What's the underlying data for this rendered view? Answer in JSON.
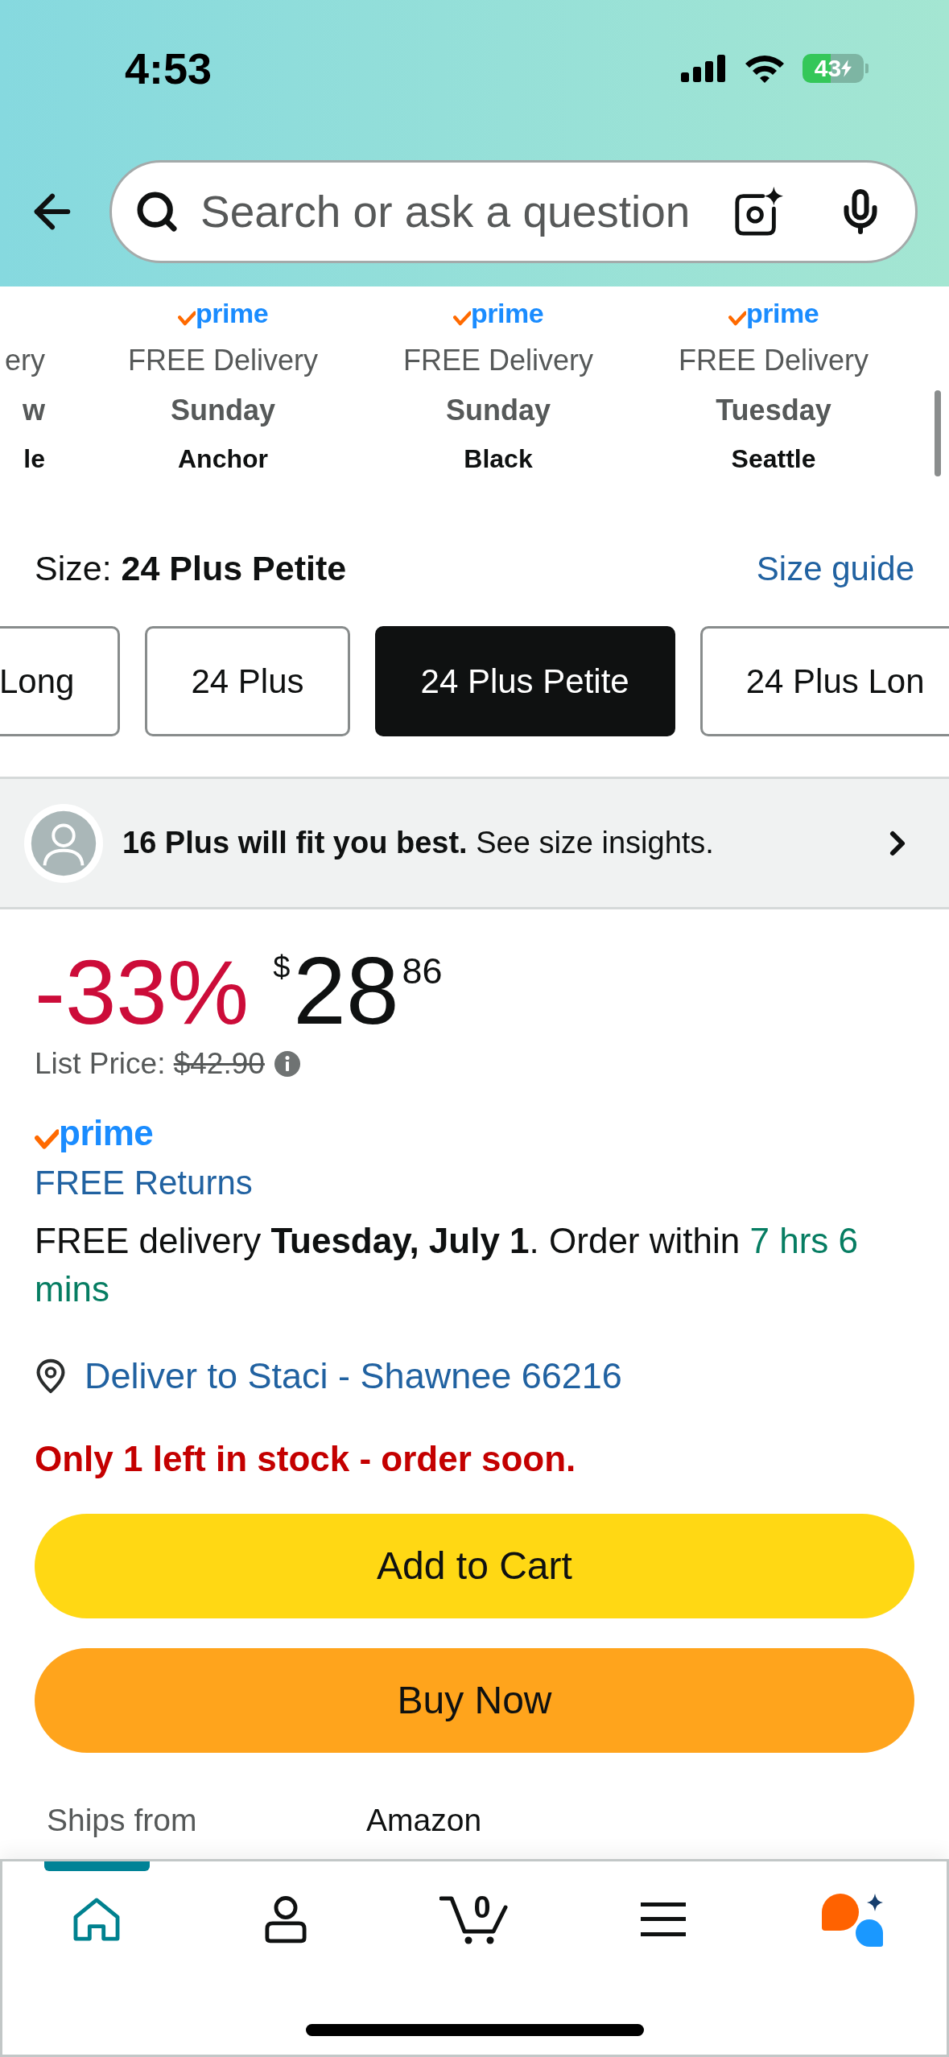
{
  "status_bar": {
    "time": "4:53",
    "battery": "43"
  },
  "search": {
    "placeholder": "Search or ask a question"
  },
  "delivery_options": [
    {
      "delivery": "ery",
      "day": "w",
      "variant": "le"
    },
    {
      "badge": "prime",
      "delivery": "FREE Delivery",
      "day": "Sunday",
      "variant": "Anchor"
    },
    {
      "badge": "prime",
      "delivery": "FREE Delivery",
      "day": "Sunday",
      "variant": "Black"
    },
    {
      "badge": "prime",
      "delivery": "FREE Delivery",
      "day": "Tuesday",
      "variant": "Seattle"
    }
  ],
  "size": {
    "label": "Size:",
    "value": "24 Plus Petite",
    "guide_link": "Size guide",
    "options": [
      {
        "label": "Long",
        "selected": false
      },
      {
        "label": "24 Plus",
        "selected": false
      },
      {
        "label": "24 Plus Petite",
        "selected": true
      },
      {
        "label": "24 Plus Lon",
        "selected": false
      }
    ]
  },
  "fit_banner": {
    "text": "**16 Plus will fit you best.** See size insights."
  },
  "price": {
    "discount": "-33%",
    "currency": "$",
    "whole": "28",
    "fraction": "86",
    "list_label": "List Price:",
    "list_price": "$42.90"
  },
  "prime_badge": "prime",
  "returns_link": "FREE Returns",
  "delivery": {
    "text": "FREE delivery **Tuesday, July 1**. Order within",
    "countdown": "7 hrs 6 mins"
  },
  "deliver_to": "Deliver to Staci - Shawnee 66216",
  "stock": "Only 1 left in stock - order soon.",
  "buttons": [
    {
      "kind": "add_to_cart",
      "label": "Add to Cart"
    },
    {
      "kind": "buy_now",
      "label": "Buy Now"
    }
  ],
  "ships_from": {
    "label": "Ships from",
    "value": "Amazon"
  },
  "bottom_nav": [
    {
      "kind": "home",
      "selected": true
    },
    {
      "kind": "account",
      "selected": false
    },
    {
      "kind": "cart",
      "selected": false,
      "count": "0"
    },
    {
      "kind": "menu",
      "selected": false
    },
    {
      "kind": "assistant",
      "selected": false
    }
  ]
}
